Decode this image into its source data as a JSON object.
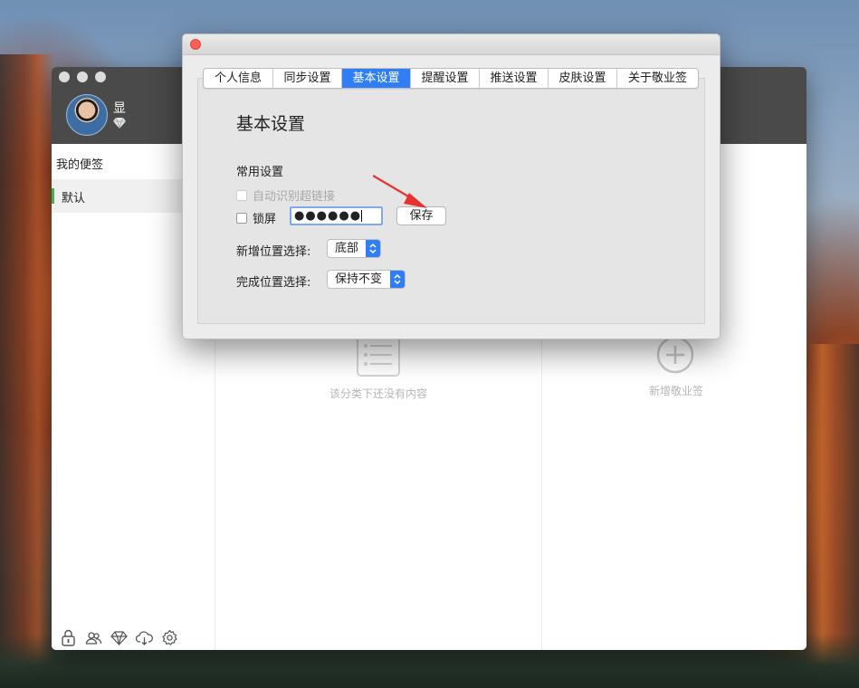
{
  "app": {
    "user_name": "显",
    "sidebar_title": "我的便签",
    "sidebar_items": [
      {
        "label": "默认"
      }
    ],
    "empty_text": "该分类下还没有内容",
    "add_label": "新增敬业签",
    "bottom_icons": [
      "lock-icon",
      "users-icon",
      "diamond-icon",
      "cloud-download-icon",
      "gear-icon"
    ]
  },
  "dialog": {
    "tabs": [
      {
        "label": "个人信息",
        "active": false
      },
      {
        "label": "同步设置",
        "active": false
      },
      {
        "label": "基本设置",
        "active": true
      },
      {
        "label": "提醒设置",
        "active": false
      },
      {
        "label": "推送设置",
        "active": false
      },
      {
        "label": "皮肤设置",
        "active": false
      },
      {
        "label": "关于敬业签",
        "active": false
      }
    ],
    "page_title": "基本设置",
    "section_title": "常用设置",
    "auto_link_label": "自动识别超链接",
    "lock_label": "锁屏",
    "password_value": "●●●●●●",
    "save_label": "保存",
    "add_position_label": "新增位置选择:",
    "add_position_value": "底部",
    "done_position_label": "完成位置选择:",
    "done_position_value": "保持不变"
  },
  "colors": {
    "accent": "#2f7ef5",
    "header_bg": "#4a4a4a",
    "close": "#fc5f57",
    "annotation_arrow": "#e8322f",
    "sidebar_marker": "#3cb35a"
  }
}
